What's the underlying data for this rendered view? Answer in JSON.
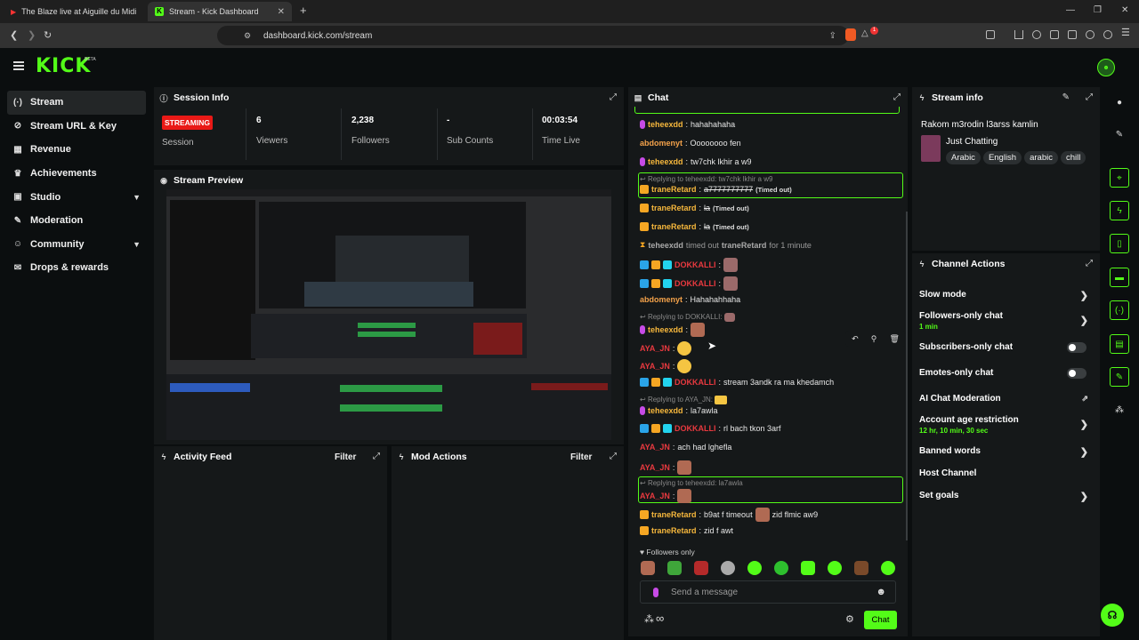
{
  "browser": {
    "tabs": [
      {
        "title": "The Blaze live at Aiguille du Midi",
        "icon": "youtube-icon"
      },
      {
        "title": "Stream - Kick Dashboard",
        "icon": "kick-icon"
      }
    ],
    "url": "dashboard.kick.com/stream",
    "notification_count": "1"
  },
  "app": {
    "logo": "KICK",
    "logo_tag": "BETA"
  },
  "sidebar": {
    "items": [
      {
        "label": "Stream",
        "icon": "broadcast-icon",
        "active": true
      },
      {
        "label": "Stream URL & Key",
        "icon": "link-icon"
      },
      {
        "label": "Revenue",
        "icon": "chart-icon"
      },
      {
        "label": "Achievements",
        "icon": "trophy-icon"
      },
      {
        "label": "Studio",
        "icon": "grid-icon",
        "has_chevron": true
      },
      {
        "label": "Moderation",
        "icon": "wrench-icon"
      },
      {
        "label": "Community",
        "icon": "people-icon",
        "has_chevron": true
      },
      {
        "label": "Drops & rewards",
        "icon": "gift-icon"
      }
    ]
  },
  "session": {
    "title": "Session Info",
    "status": "STREAMING",
    "status_label": "Session",
    "stats": [
      {
        "value": "6",
        "label": "Viewers"
      },
      {
        "value": "2,238",
        "label": "Followers"
      },
      {
        "value": "-",
        "label": "Sub Counts"
      },
      {
        "value": "00:03:54",
        "label": "Time Live"
      }
    ]
  },
  "preview": {
    "title": "Stream Preview"
  },
  "activity": {
    "title": "Activity Feed",
    "filter": "Filter"
  },
  "mod_actions": {
    "title": "Mod Actions",
    "filter": "Filter"
  },
  "chat": {
    "title": "Chat",
    "messages": [
      {
        "user": "teheexdd",
        "text": "hahahahaha"
      },
      {
        "user": "abdomenyt",
        "text": "Oooooooo fen"
      },
      {
        "user": "teheexdd",
        "text": "tw7chk lkhir a w9"
      },
      {
        "reply_to": "Replying to teheexdd: tw7chk lkhir a w9",
        "user": "traneRetard",
        "text": "a7777777777",
        "note": "(Timed out)"
      },
      {
        "user": "traneRetard",
        "text": "la",
        "note": "(Timed out)"
      },
      {
        "user": "traneRetard",
        "text": "la",
        "note": "(Timed out)"
      },
      {
        "system": "teheexdd timed out traneRetard for 1 minute",
        "user_a": "teheexdd",
        "mid": "timed out",
        "user_b": "traneRetard",
        "tail": "for 1 minute"
      },
      {
        "user": "DOKKALLI",
        "text": ""
      },
      {
        "user": "DOKKALLI",
        "text": ""
      },
      {
        "user": "abdomenyt",
        "text": "Hahahahhaha"
      },
      {
        "reply_to": "Replying to DOKKALLI:",
        "user": "teheexdd",
        "text": ""
      },
      {
        "user": "AYA_JN",
        "text": ""
      },
      {
        "user": "AYA_JN",
        "text": ""
      },
      {
        "user": "DOKKALLI",
        "text": "stream 3andk ra ma khedamch"
      },
      {
        "reply_to": "Replying to AYA_JN:",
        "user": "teheexdd",
        "text": "la7awla"
      },
      {
        "user": "DOKKALLI",
        "text": "rl bach tkon 3arf"
      },
      {
        "user": "AYA_JN",
        "text": "ach had lghefla"
      },
      {
        "user": "AYA_JN",
        "text": ""
      },
      {
        "reply_to": "Replying to teheexdd: la7awla",
        "user": "AYA_JN",
        "text": ""
      },
      {
        "user": "traneRetard",
        "text": "b9at f timeout",
        "text2": "zid flmic aw9"
      },
      {
        "user": "traneRetard",
        "text": "zid f awt"
      }
    ],
    "followers_only": "Followers only",
    "input_placeholder": "Send a message",
    "send_label": "Chat",
    "infinity": "∞"
  },
  "stream_info": {
    "title": "Stream info",
    "stream_title": "Rakom m3rodin l3arss kamlin",
    "category": "Just Chatting",
    "tags": [
      "Arabic",
      "English",
      "arabic",
      "chill"
    ]
  },
  "channel_actions": {
    "title": "Channel Actions",
    "items": [
      {
        "label": "Slow mode",
        "control": "chevron"
      },
      {
        "label": "Followers-only chat",
        "sub": "1 min",
        "control": "chevron"
      },
      {
        "label": "Subscribers-only chat",
        "control": "toggle"
      },
      {
        "label": "Emotes-only chat",
        "control": "toggle"
      },
      {
        "label": "AI Chat Moderation",
        "control": "external"
      },
      {
        "label": "Account age restriction",
        "sub": "12 hr, 10 min, 30 sec",
        "control": "chevron"
      },
      {
        "label": "Banned words",
        "control": "chevron"
      },
      {
        "label": "Host Channel",
        "control": "none"
      },
      {
        "label": "Set goals",
        "control": "chevron"
      }
    ]
  },
  "colors": {
    "accent": "#53fc18",
    "streaming": "#e91916",
    "bg": "#0b0e0f",
    "panel": "#151819"
  }
}
